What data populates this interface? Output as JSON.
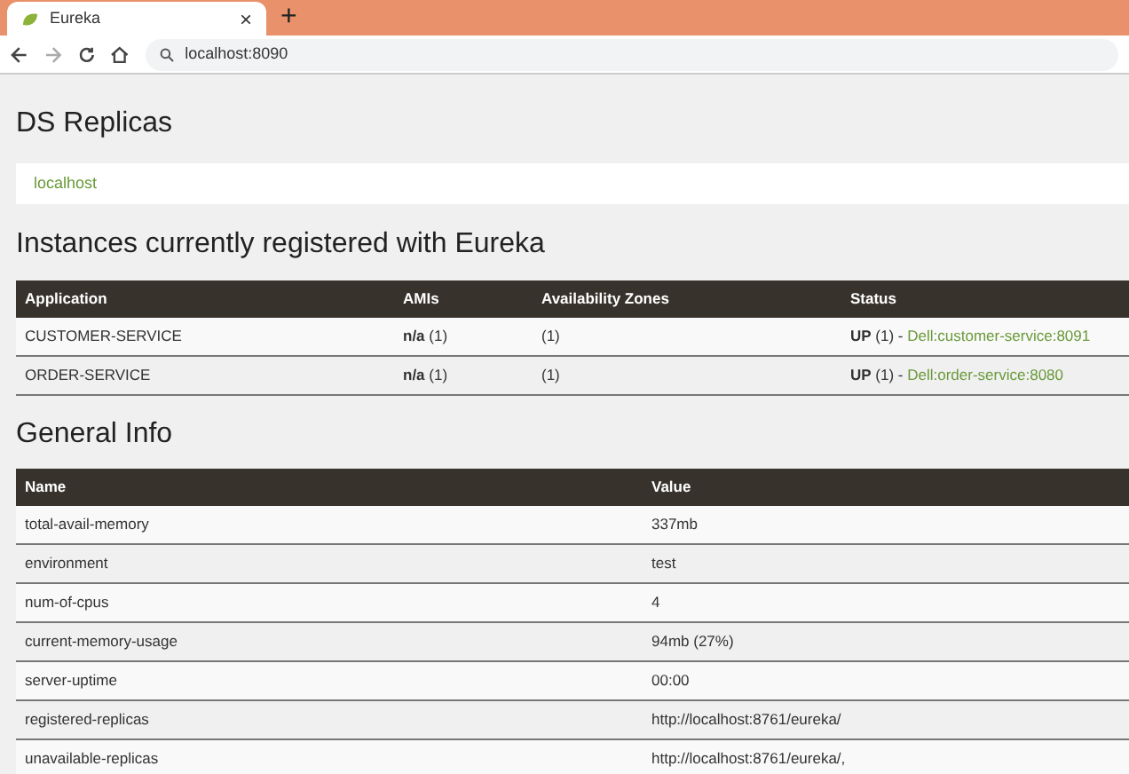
{
  "browser": {
    "tab_title": "Eureka",
    "close": "×",
    "new_tab": "+",
    "address": "localhost:8090"
  },
  "ds_replicas": {
    "heading": "DS Replicas",
    "items": [
      "localhost"
    ]
  },
  "instances": {
    "heading": "Instances currently registered with Eureka",
    "columns": [
      "Application",
      "AMIs",
      "Availability Zones",
      "Status"
    ],
    "rows": [
      {
        "application": "CUSTOMER-SERVICE",
        "amis": "**n/a** (1)",
        "zones": "(1)",
        "status": "**UP** (1) - ",
        "status_link": "Dell:customer-service:8091"
      },
      {
        "application": "ORDER-SERVICE",
        "amis": "**n/a** (1)",
        "zones": "(1)",
        "status": "**UP** (1) - ",
        "status_link": "Dell:order-service:8080"
      }
    ]
  },
  "general_info": {
    "heading": "General Info",
    "columns": [
      "Name",
      "Value"
    ],
    "rows": [
      {
        "name": "total-avail-memory",
        "value": "337mb"
      },
      {
        "name": "environment",
        "value": "test"
      },
      {
        "name": "num-of-cpus",
        "value": "4"
      },
      {
        "name": "current-memory-usage",
        "value": "94mb (27%)"
      },
      {
        "name": "server-uptime",
        "value": "00:00"
      },
      {
        "name": "registered-replicas",
        "value": "http://localhost:8761/eureka/"
      },
      {
        "name": "unavailable-replicas",
        "value": "http://localhost:8761/eureka/,"
      }
    ]
  }
}
